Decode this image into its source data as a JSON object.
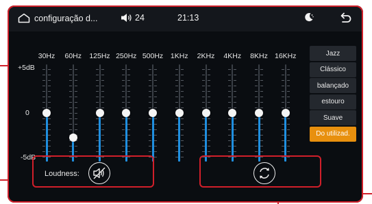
{
  "status": {
    "title": "configuração d...",
    "volume": "24",
    "time": "21:13"
  },
  "eq": {
    "db_labels": [
      "+5dB",
      "0",
      "-5dB"
    ],
    "bands": [
      {
        "freq": "30Hz",
        "level": 0
      },
      {
        "freq": "60Hz",
        "level": -2.5
      },
      {
        "freq": "125Hz",
        "level": 0
      },
      {
        "freq": "250Hz",
        "level": 0
      },
      {
        "freq": "500Hz",
        "level": 0
      },
      {
        "freq": "1KHz",
        "level": 0
      },
      {
        "freq": "2KHz",
        "level": 0
      },
      {
        "freq": "4KHz",
        "level": 0
      },
      {
        "freq": "8KHz",
        "level": 0
      },
      {
        "freq": "16KHz",
        "level": 0
      }
    ],
    "range": [
      -5,
      5
    ]
  },
  "presets": [
    {
      "label": "Jazz",
      "active": false
    },
    {
      "label": "Clássico",
      "active": false
    },
    {
      "label": "balançado",
      "active": false
    },
    {
      "label": "estouro",
      "active": false
    },
    {
      "label": "Suave",
      "active": false
    },
    {
      "label": "Do utilizad.",
      "active": true
    }
  ],
  "loudness": {
    "label": "Loudness:",
    "enabled": false
  },
  "colors": {
    "accent": "#e8900e",
    "fill": "#1f8fe0",
    "highlight": "#d11f2a"
  },
  "icons": [
    "home-icon",
    "speaker-icon",
    "night-mode-icon",
    "back-arrow-icon",
    "speaker-muted-icon",
    "reset-icon"
  ]
}
